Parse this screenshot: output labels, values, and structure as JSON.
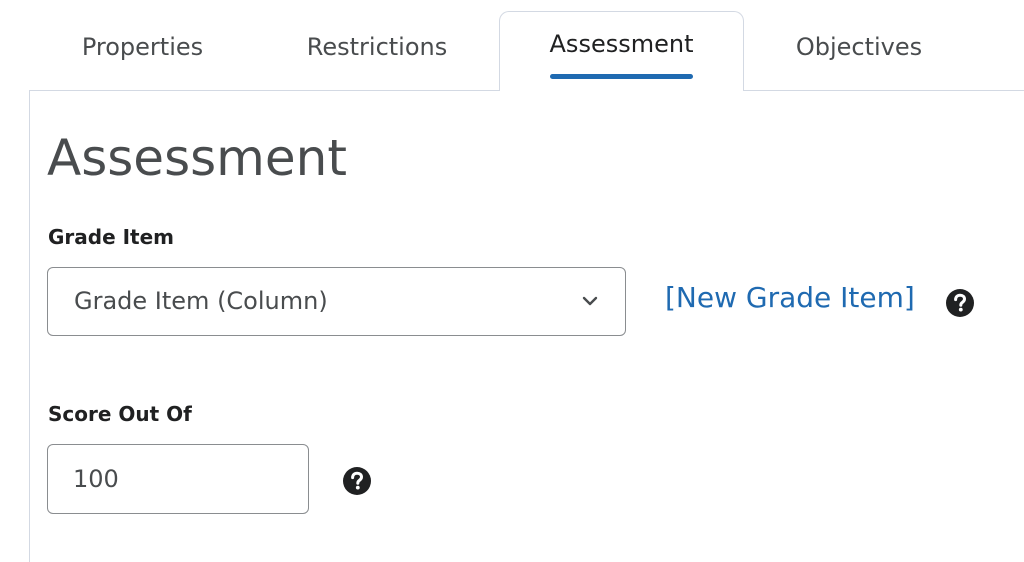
{
  "tabs": [
    {
      "label": "Properties",
      "active": false
    },
    {
      "label": "Restrictions",
      "active": false
    },
    {
      "label": "Assessment",
      "active": true
    },
    {
      "label": "Objectives",
      "active": false
    }
  ],
  "page": {
    "heading": "Assessment"
  },
  "grade_item": {
    "label": "Grade Item",
    "selected_value": "Grade Item (Column)",
    "new_link": "[New Grade Item]",
    "help_icon": "question-circle-icon"
  },
  "score_out_of": {
    "label": "Score Out Of",
    "value": "100",
    "help_icon": "question-circle-icon"
  },
  "colors": {
    "accent": "#1f6ab1",
    "border": "#d3d9e3",
    "text": "#494c4e"
  }
}
